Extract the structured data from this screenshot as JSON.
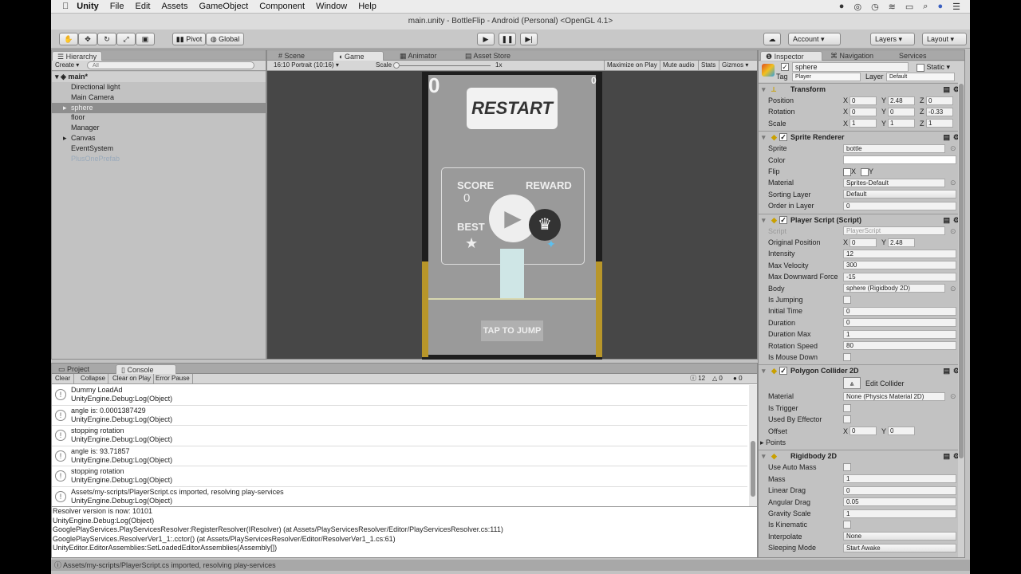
{
  "menubar": {
    "app": "Unity",
    "items": [
      "File",
      "Edit",
      "Assets",
      "GameObject",
      "Component",
      "Window",
      "Help"
    ]
  },
  "window_title": "main.unity - BottleFlip - Android (Personal) <OpenGL 4.1>",
  "toolbar": {
    "pivot": "Pivot",
    "global": "Global",
    "account": "Account",
    "layers": "Layers",
    "layout": "Layout"
  },
  "hierarchy": {
    "tab": "Hierarchy",
    "create": "Create",
    "search_placeholder": "All",
    "scene": "main*",
    "items": [
      {
        "label": "Directional light"
      },
      {
        "label": "Main Camera"
      },
      {
        "label": "sphere",
        "selected": true,
        "expandable": true
      },
      {
        "label": "floor"
      },
      {
        "label": "Manager"
      },
      {
        "label": "Canvas",
        "expandable": true
      },
      {
        "label": "EventSystem"
      },
      {
        "label": "PlusOnePrefab",
        "disabled": true
      }
    ]
  },
  "center": {
    "tabs": [
      "Scene",
      "Game",
      "Animator",
      "Asset Store"
    ],
    "active_tab": "Game",
    "aspect": "16:10 Portrait (10:16)",
    "scale_label": "Scale",
    "scale_value": "1x",
    "buttons": [
      "Maximize on Play",
      "Mute audio",
      "Stats",
      "Gizmos"
    ]
  },
  "game": {
    "score_left": "0",
    "score_right": "0",
    "restart": "RESTART",
    "score_label": "SCORE",
    "score_value": "0",
    "best_label": "BEST",
    "reward_label": "REWARD",
    "tap": "TAP TO JUMP"
  },
  "inspector": {
    "tabs": [
      "Inspector",
      "Navigation",
      "Services"
    ],
    "object_name": "sphere",
    "static_label": "Static",
    "tag_label": "Tag",
    "tag": "Player",
    "layer_label": "Layer",
    "layer": "Default",
    "components": [
      {
        "title": "Transform",
        "rows": [
          {
            "label": "Position",
            "xyz": [
              "0",
              "2.48",
              "0"
            ]
          },
          {
            "label": "Rotation",
            "xyz": [
              "0",
              "0",
              "-0.33"
            ]
          },
          {
            "label": "Scale",
            "xyz": [
              "1",
              "1",
              "1"
            ]
          }
        ]
      },
      {
        "title": "Sprite Renderer",
        "rows": [
          {
            "label": "Sprite",
            "value": "bottle"
          },
          {
            "label": "Color",
            "value": ""
          },
          {
            "label": "Flip",
            "flip": [
              "X",
              "Y"
            ]
          },
          {
            "label": "Material",
            "value": "Sprites-Default"
          },
          {
            "label": "Sorting Layer",
            "value": "Default",
            "dropdown": true
          },
          {
            "label": "Order in Layer",
            "value": "0"
          }
        ]
      },
      {
        "title": "Player Script (Script)",
        "rows": [
          {
            "label": "Script",
            "value": "PlayerScript",
            "disabled": true
          },
          {
            "label": "Original Position",
            "xy": [
              "0",
              "2.48"
            ]
          },
          {
            "label": "Intensity",
            "value": "12"
          },
          {
            "label": "Max Velocity",
            "value": "300"
          },
          {
            "label": "Max Downward Force",
            "value": "-15"
          },
          {
            "label": "Body",
            "value": "sphere (Rigidbody 2D)"
          },
          {
            "label": "Is Jumping",
            "check": false
          },
          {
            "label": "Initial Time",
            "value": "0"
          },
          {
            "label": "Duration",
            "value": "0"
          },
          {
            "label": "Duration Max",
            "value": "1"
          },
          {
            "label": "Rotation Speed",
            "value": "80"
          },
          {
            "label": "Is Mouse Down",
            "check": false
          }
        ]
      },
      {
        "title": "Polygon Collider 2D",
        "edit_collider": "Edit Collider",
        "rows": [
          {
            "label": "Material",
            "value": "None (Physics Material 2D)"
          },
          {
            "label": "Is Trigger",
            "check": false
          },
          {
            "label": "Used By Effector",
            "check": false
          },
          {
            "label": "Offset",
            "xy": [
              "0",
              "0"
            ]
          },
          {
            "label": "Points",
            "foldout": true
          }
        ]
      },
      {
        "title": "Rigidbody 2D",
        "rows": [
          {
            "label": "Use Auto Mass",
            "check": false
          },
          {
            "label": "Mass",
            "value": "1"
          },
          {
            "label": "Linear Drag",
            "value": "0"
          },
          {
            "label": "Angular Drag",
            "value": "0.05"
          },
          {
            "label": "Gravity Scale",
            "value": "1"
          },
          {
            "label": "Is Kinematic",
            "check": false
          },
          {
            "label": "Interpolate",
            "value": "None",
            "dropdown": true
          },
          {
            "label": "Sleeping Mode",
            "value": "Start Awake",
            "dropdown": true
          }
        ]
      }
    ]
  },
  "console": {
    "tabs": [
      "Project",
      "Console"
    ],
    "buttons": [
      "Clear",
      "Collapse",
      "Clear on Play",
      "Error Pause"
    ],
    "counts": {
      "log": "12",
      "warn": "0",
      "error": "0"
    },
    "entries": [
      {
        "msg": "Dummy LoadAd",
        "trace": "UnityEngine.Debug:Log(Object)"
      },
      {
        "msg": "angle is: 0.0001387429",
        "trace": "UnityEngine.Debug:Log(Object)"
      },
      {
        "msg": "stopping rotation",
        "trace": "UnityEngine.Debug:Log(Object)"
      },
      {
        "msg": "angle is: 93.71857",
        "trace": "UnityEngine.Debug:Log(Object)"
      },
      {
        "msg": "stopping rotation",
        "trace": "UnityEngine.Debug:Log(Object)"
      },
      {
        "msg": "Assets/my-scripts/PlayerScript.cs imported, resolving play-services",
        "trace": "UnityEngine.Debug:Log(Object)"
      }
    ],
    "detail": [
      "Resolver version is now: 10101",
      "UnityEngine.Debug:Log(Object)",
      "GooglePlayServices.PlayServicesResolver:RegisterResolver(IResolver) (at Assets/PlayServicesResolver/Editor/PlayServicesResolver.cs:111)",
      "GooglePlayServices.ResolverVer1_1:.cctor() (at Assets/PlayServicesResolver/Editor/ResolverVer1_1.cs:61)",
      "UnityEditor.EditorAssemblies:SetLoadedEditorAssemblies(Assembly[])"
    ]
  },
  "statusbar": "Assets/my-scripts/PlayerScript.cs imported, resolving play-services"
}
